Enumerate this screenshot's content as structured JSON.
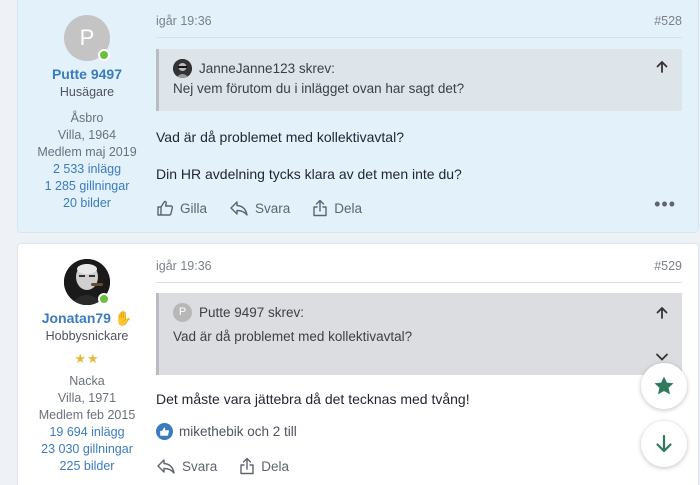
{
  "posts": [
    {
      "author": {
        "avatar_letter": "P",
        "name": "Putte 9497",
        "title": "Husägare",
        "location": "Åsbro",
        "house": "Villa, 1964",
        "member_since": "Medlem maj 2019",
        "posts_count": "2 533 inlägg",
        "likes_count": "1 285 gillningar",
        "images_count": "20 bilder"
      },
      "time": "igår 19:36",
      "number": "#528",
      "quote": {
        "author_label": "JanneJanne123 skrev:",
        "text": "Nej vem förutom du i inlägget ovan har sagt det?"
      },
      "message_lines": [
        "Vad är då problemet med kollektivavtal?",
        "Din HR avdelning tycks klara av det men inte du?"
      ],
      "actions": {
        "like": "Gilla",
        "reply": "Svara",
        "share": "Dela",
        "more": "•••"
      }
    },
    {
      "author": {
        "name": "Jonatan79",
        "badge": "✋",
        "title": "Hobbysnickare",
        "stars": "★★",
        "location": "Nacka",
        "house": "Villa, 1971",
        "member_since": "Medlem feb 2015",
        "posts_count": "19 694 inlägg",
        "likes_count": "23 030 gillningar",
        "images_count": "225 bilder"
      },
      "time": "igår 19:36",
      "number": "#529",
      "quote": {
        "avatar_letter": "P",
        "author_label": "Putte 9497 skrev:",
        "text": "Vad är då problemet med kollektivavtal?"
      },
      "message_lines": [
        "Det måste vara jättebra då det tecknas med tvång!"
      ],
      "reactions": "mikethebik och 2 till",
      "actions": {
        "reply": "Svara",
        "share": "Dela"
      }
    }
  ],
  "fabs": {
    "favorite_icon": "star-icon",
    "scroll_down_icon": "arrow-down-icon"
  },
  "colors": {
    "accent": "#3b7bbf",
    "highlight_bg": "#e3f1fb",
    "online": "#6cbf3c",
    "fab_icon": "#2f7a5a",
    "star": "#e8b83a"
  }
}
